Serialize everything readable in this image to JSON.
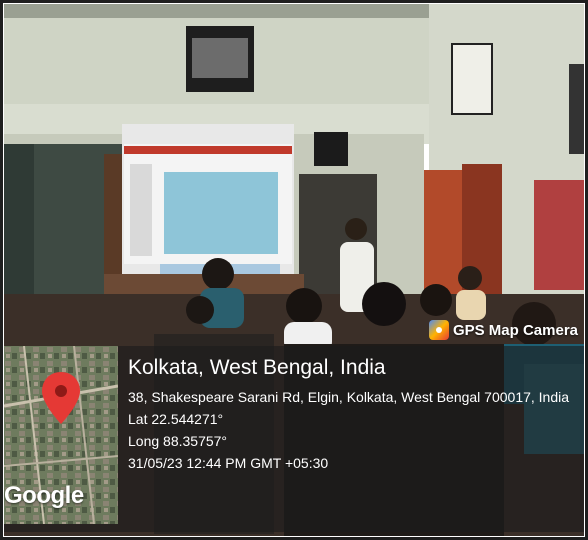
{
  "badge": {
    "label": "GPS Map Camera",
    "icon": "map-camera-icon"
  },
  "map": {
    "watermark": "Google",
    "pin_icon": "location-pin-icon"
  },
  "location": {
    "city": "Kolkata, West Bengal, India",
    "address": "38, Shakespeare Sarani Rd, Elgin, Kolkata, West Bengal 700017, India",
    "lat": "Lat 22.544271°",
    "long": "Long 88.35757°",
    "datetime": "31/05/23 12:44 PM GMT +05:30"
  },
  "colors": {
    "overlay": "#1c1c1c",
    "pin": "#e53935",
    "wall": "#d9ddd0",
    "screen_slide": "#8ec5d8"
  }
}
